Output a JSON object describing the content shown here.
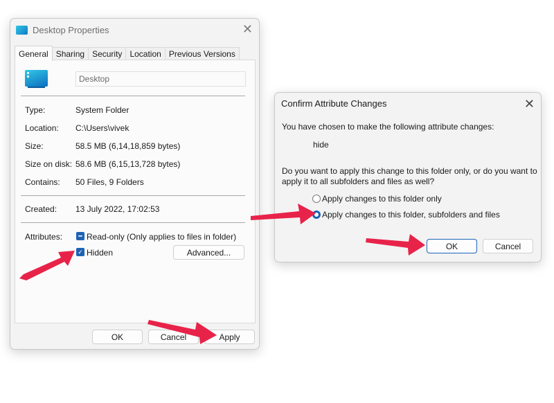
{
  "properties_window": {
    "title": "Desktop Properties",
    "close_icon": "close-icon",
    "tabs": [
      {
        "label": "General",
        "active": true
      },
      {
        "label": "Sharing",
        "active": false
      },
      {
        "label": "Security",
        "active": false
      },
      {
        "label": "Location",
        "active": false
      },
      {
        "label": "Previous Versions",
        "active": false
      }
    ],
    "folder_name": "Desktop",
    "info": [
      {
        "key": "Type:",
        "value": "System Folder"
      },
      {
        "key": "Location:",
        "value": "C:\\Users\\vivek"
      },
      {
        "key": "Size:",
        "value": "58.5 MB (6,14,18,859 bytes)"
      },
      {
        "key": "Size on disk:",
        "value": "58.6 MB (6,15,13,728 bytes)"
      },
      {
        "key": "Contains:",
        "value": "50 Files, 9 Folders"
      }
    ],
    "created": {
      "key": "Created:",
      "value": "13 July 2022, 17:02:53"
    },
    "attributes": {
      "label": "Attributes:",
      "readonly": {
        "label": "Read-only (Only applies to files in folder)",
        "state": "indeterminate"
      },
      "hidden": {
        "label": "Hidden",
        "state": "checked"
      },
      "advanced_label": "Advanced..."
    },
    "buttons": {
      "ok": "OK",
      "cancel": "Cancel",
      "apply": "Apply"
    }
  },
  "confirm_dialog": {
    "title": "Confirm Attribute Changes",
    "intro": "You have chosen to make the following attribute changes:",
    "change": "hide",
    "question_line1": "Do you want to apply this change to this folder only, or do you want to",
    "question_line2": "apply it to all subfolders and files as well?",
    "options": [
      {
        "label": "Apply changes to this folder only",
        "selected": false
      },
      {
        "label": "Apply changes to this folder, subfolders and files",
        "selected": true
      }
    ],
    "buttons": {
      "ok": "OK",
      "cancel": "Cancel"
    }
  },
  "annotation_color": "#e8234a",
  "accent_color": "#1b62b6"
}
